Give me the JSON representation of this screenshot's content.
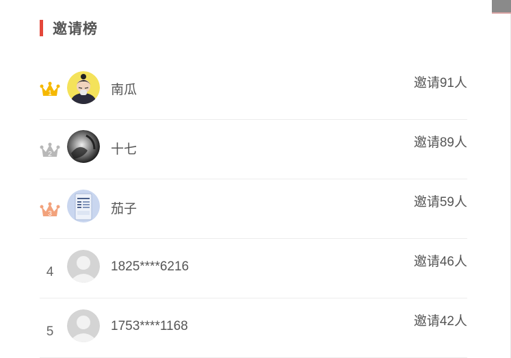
{
  "header": {
    "title": "邀请榜",
    "accent_color": "#e4473a"
  },
  "ranking": {
    "count_prefix": "邀请",
    "count_suffix": "人",
    "rows": [
      {
        "rank": "1",
        "rank_style": "gold-crown",
        "crown_color": "#f5b800",
        "avatar": "cartoon-person-avatar",
        "name": "南瓜",
        "count": "91"
      },
      {
        "rank": "2",
        "rank_style": "silver-crown",
        "crown_color": "#b8b8b8",
        "avatar": "black-white-portrait-avatar",
        "name": "十七",
        "count": "89"
      },
      {
        "rank": "3",
        "rank_style": "bronze-crown",
        "crown_color": "#f2a27c",
        "avatar": "phone-screenshot-avatar",
        "name": "茄子",
        "count": "59"
      },
      {
        "rank": "4",
        "rank_style": "plain",
        "avatar": "default-user-avatar",
        "name": "1825****6216",
        "count": "46"
      },
      {
        "rank": "5",
        "rank_style": "plain",
        "avatar": "default-user-avatar",
        "name": "1753****1168",
        "count": "42"
      }
    ]
  }
}
